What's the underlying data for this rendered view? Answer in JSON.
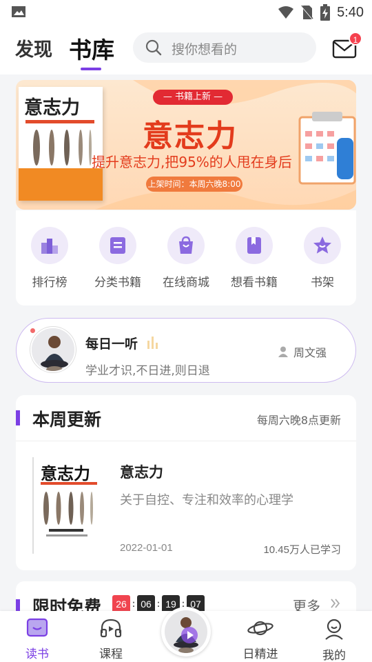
{
  "status_bar": {
    "time": "5:40"
  },
  "header": {
    "tabs": [
      {
        "label": "发现"
      },
      {
        "label": "书库"
      }
    ],
    "search_placeholder": "搜你想看的",
    "mail_badge": "1"
  },
  "banner": {
    "book_title": "意志力",
    "tag": "— 书籍上新 —",
    "title": "意志力",
    "subtitle": "提升意志力,把95%的人甩在身后",
    "release_time": "上架时间：本周六晚8:00"
  },
  "quick_nav": [
    {
      "label": "排行榜",
      "icon": "ranking-icon"
    },
    {
      "label": "分类书籍",
      "icon": "category-book-icon"
    },
    {
      "label": "在线商城",
      "icon": "shopping-bag-icon"
    },
    {
      "label": "想看书籍",
      "icon": "bookmark-book-icon"
    },
    {
      "label": "书架",
      "icon": "star-shelf-icon"
    }
  ],
  "daily_listen": {
    "title": "每日一听",
    "subtitle": "学业才识,不日进,则日退",
    "author": "周文强"
  },
  "weekly_update": {
    "title": "本周更新",
    "note": "每周六晚8点更新",
    "book": {
      "cover_title": "意志力",
      "title": "意志力",
      "description": "关于自控、专注和效率的心理学",
      "date": "2022-01-01",
      "learners": "10.45万人已学习"
    }
  },
  "limited_free": {
    "title": "限时免费",
    "timer": [
      "26",
      "06",
      "19",
      "07"
    ],
    "more": "更多"
  },
  "bottom_nav": [
    {
      "label": "读书",
      "active": true
    },
    {
      "label": "课程"
    },
    {
      "label": "日精进"
    },
    {
      "label": "我的"
    }
  ],
  "colors": {
    "accent": "#7b3fe4",
    "banner_red": "#e33b1c",
    "badge_red": "#f5414e"
  }
}
